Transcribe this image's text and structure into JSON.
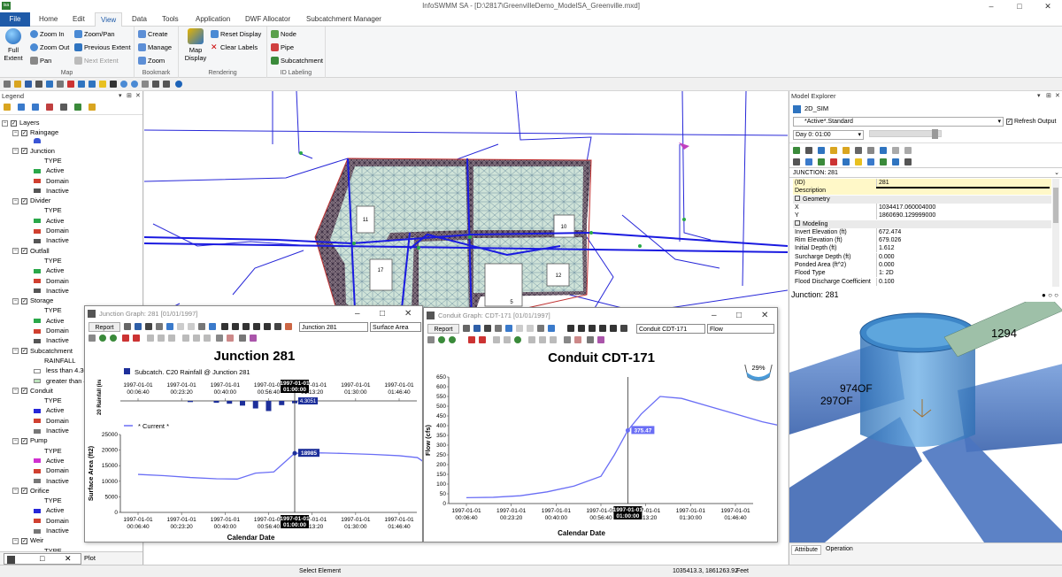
{
  "window": {
    "title": "InfoSWMM SA - [D:\\2817\\GreenvilleDemo_ModelSA_Greenville.mxd]",
    "logo_text": "isa"
  },
  "ribbon": {
    "tabs": [
      "File",
      "Home",
      "Edit",
      "View",
      "Data",
      "Tools",
      "Application",
      "DWF Allocator",
      "Subcatchment Manager"
    ],
    "active_tab": "View",
    "map_group": {
      "label": "Map",
      "full_extent": "Full Extent",
      "zoom_in": "Zoom In",
      "zoom_out": "Zoom Out",
      "pan": "Pan",
      "zoom_pan": "Zoom/Pan",
      "previous_extent": "Previous Extent",
      "next_extent": "Next Extent"
    },
    "bookmark_group": {
      "label": "Bookmark",
      "create": "Create",
      "manage": "Manage",
      "zoom": "Zoom"
    },
    "rendering_group": {
      "label": "Rendering",
      "map_display": "Map Display",
      "reset_display": "Reset Display",
      "clear_labels": "Clear Labels"
    },
    "id_labeling_group": {
      "label": "ID Labeling",
      "node": "Node",
      "pipe": "Pipe",
      "subcatchment": "Subcatchment"
    }
  },
  "legend": {
    "title": "Legend",
    "root": "Layers",
    "layers": [
      {
        "name": "Raingage",
        "items": []
      },
      {
        "name": "Junction",
        "items": [
          "TYPE",
          "Active",
          "Domain",
          "Inactive"
        ]
      },
      {
        "name": "Divider",
        "items": [
          "TYPE",
          "Active",
          "Domain",
          "Inactive"
        ]
      },
      {
        "name": "Outfall",
        "items": [
          "TYPE",
          "Active",
          "Domain",
          "Inactive"
        ]
      },
      {
        "name": "Storage",
        "items": [
          "TYPE",
          "Active",
          "Domain",
          "Inactive"
        ]
      },
      {
        "name": "Subcatchment",
        "items": [
          "RAINFALL",
          "less than 4.305",
          "greater than 4.3"
        ]
      },
      {
        "name": "Conduit",
        "items": [
          "TYPE",
          "Active",
          "Domain",
          "Inactive"
        ]
      },
      {
        "name": "Pump",
        "items": [
          "TYPE",
          "Active",
          "Domain",
          "Inactive"
        ]
      },
      {
        "name": "Orifice",
        "items": [
          "TYPE",
          "Active",
          "Domain",
          "Inactive"
        ]
      },
      {
        "name": "Weir",
        "items": [
          "TYPE"
        ]
      }
    ],
    "bottom_tab": "Plot"
  },
  "map": {
    "subcatchment_labels": [
      "11",
      "10",
      "17",
      "12",
      "5"
    ]
  },
  "junction_graph": {
    "title": "Junction Graph: 281 [01/01/1997]",
    "report_button": "Report",
    "element_select": "Junction 281",
    "variable_select": "Surface Area",
    "chart_title": "Junction 281",
    "legend_rain": "Subcatch. C20 Rainfall @ Junction 281",
    "legend_current": "* Current *",
    "ylabel_top": "20 Rainfall (in/hr)",
    "ylabel": "Surface Area (ft2)",
    "xlabel": "Calendar Date",
    "cursor_label": "1997-01-01 01:00:00",
    "cursor_rain_value": "4.3051",
    "cursor_value": "18985"
  },
  "conduit_graph": {
    "title": "Conduit Graph: CDT-171 [01/01/1997]",
    "report_button": "Report",
    "element_select": "Conduit CDT-171",
    "variable_select": "Flow",
    "chart_title": "Conduit CDT-171",
    "depth_percent": "29%",
    "ylabel": "Flow (cfs)",
    "xlabel": "Calendar Date",
    "cursor_label": "1997-01-01 01:00:00",
    "cursor_value": "375.47"
  },
  "chart_data": [
    {
      "type": "bar",
      "title": "Junction 281",
      "ylabel": "20 Rainfall (in/hr)",
      "series": [
        {
          "name": "Subcatch. C20 Rainfall @ Junction 281",
          "values": [
            0.5,
            0.8,
            1.2,
            2.0,
            3.2,
            4.3051,
            1.8,
            1.0
          ],
          "x_minutes": [
            20,
            30,
            35,
            40,
            45,
            50,
            55,
            60
          ]
        }
      ],
      "color": "#1d2f9a"
    },
    {
      "type": "line",
      "title": "Junction 281",
      "xlabel": "Calendar Date",
      "ylabel": "Surface Area (ft2)",
      "x_ticks": [
        "1997-01-01 00:06:40",
        "1997-01-01 00:23:20",
        "1997-01-01 00:40:00",
        "1997-01-01 00:56:40",
        "1997-01-01 01:13:20",
        "1997-01-01 01:30:00",
        "1997-01-01 01:46:40"
      ],
      "y_ticks": [
        "0",
        "5000",
        "10000",
        "15000",
        "20000",
        "25000"
      ],
      "ylim": [
        0,
        25000
      ],
      "series": [
        {
          "name": "* Current *",
          "x_minutes": [
            0,
            10,
            20,
            30,
            38,
            45,
            52,
            60,
            70,
            80,
            90,
            100,
            107,
            115
          ],
          "values": [
            12200,
            11800,
            11200,
            10800,
            10700,
            12600,
            13000,
            18985,
            19100,
            18900,
            18600,
            18200,
            17600,
            13000
          ]
        }
      ],
      "color": "#6a6ef5"
    },
    {
      "type": "line",
      "title": "Conduit CDT-171",
      "xlabel": "Calendar Date",
      "ylabel": "Flow (cfs)",
      "x_ticks": [
        "1997-01-01 00:06:40",
        "1997-01-01 00:23:20",
        "1997-01-01 00:40:00",
        "1997-01-01 00:56:40",
        "1997-01-01 01:13:20",
        "1997-01-01 01:30:00",
        "1997-01-01 01:46:40"
      ],
      "y_ticks": [
        "0",
        "50",
        "100",
        "150",
        "200",
        "250",
        "300",
        "350",
        "400",
        "450",
        "500",
        "550",
        "600",
        "650"
      ],
      "ylim": [
        0,
        650
      ],
      "series": [
        {
          "name": "Flow",
          "x_minutes": [
            0,
            10,
            20,
            30,
            40,
            50,
            55,
            60,
            65,
            72,
            80,
            90,
            100,
            110,
            120
          ],
          "values": [
            30,
            32,
            40,
            60,
            90,
            140,
            250,
            375.47,
            460,
            550,
            540,
            500,
            460,
            420,
            390
          ]
        }
      ],
      "color": "#6a6ef5"
    }
  ],
  "explorer": {
    "title": "Model Explorer",
    "scenario": "2D_SIM",
    "active_select": "*Active*.Standard",
    "refresh_label": "Refresh Output",
    "day_select": "Day 0:  01:00",
    "element_header": "JUNCTION: 281",
    "properties": [
      {
        "k": "(ID)",
        "v": "281",
        "hl": true
      },
      {
        "k": "Description",
        "v": "",
        "hl": true
      },
      {
        "k": "Geometry",
        "v": "",
        "sec": true
      },
      {
        "k": "X",
        "v": "1034417.060004000"
      },
      {
        "k": "Y",
        "v": "1860690.129999000"
      },
      {
        "k": "Modeling",
        "v": "",
        "sec": true
      },
      {
        "k": "Invert Elevation (ft)",
        "v": "672.474"
      },
      {
        "k": "Rim Elevation (ft)",
        "v": "679.026"
      },
      {
        "k": "Initial Depth (ft)",
        "v": "1.612"
      },
      {
        "k": "Surcharge Depth (ft)",
        "v": "0.000"
      },
      {
        "k": "Ponded Area (ft^2)",
        "v": "0.000"
      },
      {
        "k": "Flood Type",
        "v": "1: 2D"
      },
      {
        "k": "Flood Discharge Coefficient",
        "v": "0.100"
      }
    ],
    "view3d_title": "Junction: 281",
    "view3d_labels": [
      "1294",
      "974OF",
      "297OF"
    ],
    "bottom_tabs": [
      "Attribute",
      "Operation"
    ]
  },
  "status": {
    "center": "Select Element",
    "coords": "1035413.3, 1861263.92",
    "units": "Feet"
  }
}
